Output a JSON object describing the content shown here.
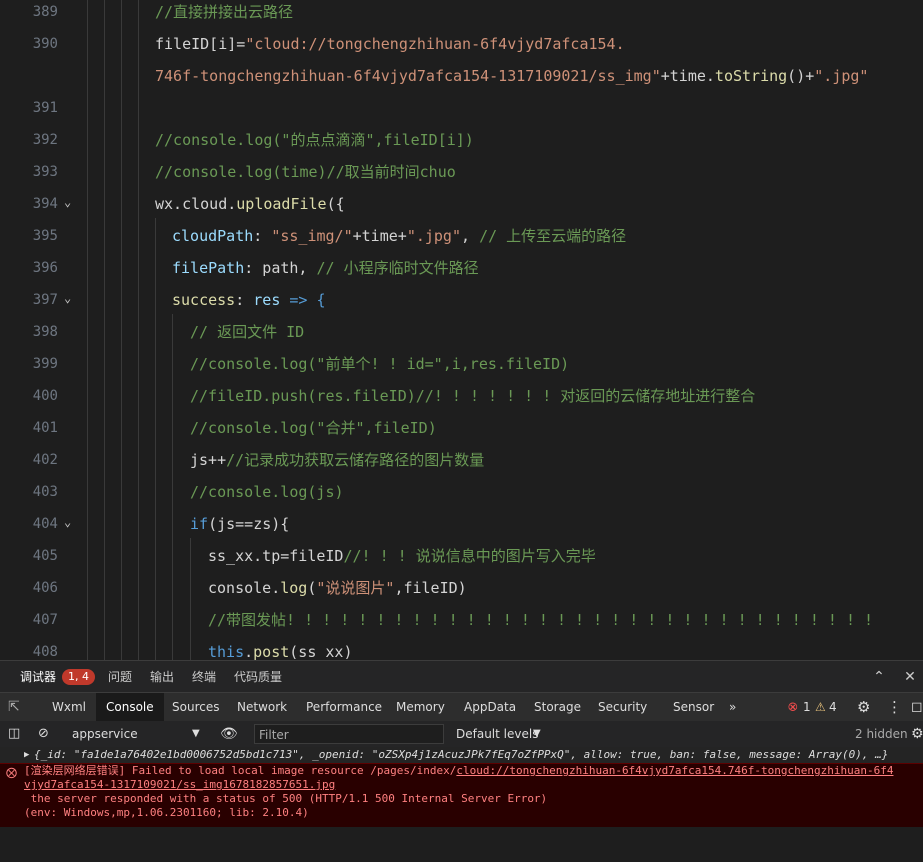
{
  "editor": {
    "lines": [
      {
        "num": "389",
        "fold": false,
        "indent": 155,
        "tokens": [
          {
            "t": "//直接拼接出云路径",
            "c": "c"
          }
        ]
      },
      {
        "num": "390",
        "fold": false,
        "indent": 155,
        "tokens": [
          {
            "t": "fileID[i]=",
            "c": "o"
          },
          {
            "t": "\"cloud://tongchengzhihuan-6f4vjyd7afca154.",
            "c": "s"
          }
        ]
      },
      {
        "num": "",
        "fold": false,
        "indent": 155,
        "tokens": [
          {
            "t": "746f-tongchengzhihuan-6f4vjyd7afca154-1317109021/ss_img\"",
            "c": "s"
          },
          {
            "t": "+time.",
            "c": "o"
          },
          {
            "t": "toString",
            "c": "f"
          },
          {
            "t": "()+",
            "c": "o"
          },
          {
            "t": "\".jpg\"",
            "c": "s"
          }
        ]
      },
      {
        "num": "391",
        "fold": false,
        "indent": 155,
        "tokens": []
      },
      {
        "num": "392",
        "fold": false,
        "indent": 155,
        "tokens": [
          {
            "t": "//console.log(\"的点点滴滴\",fileID[i])",
            "c": "c"
          }
        ]
      },
      {
        "num": "393",
        "fold": false,
        "indent": 155,
        "tokens": [
          {
            "t": "//console.log(time)//取当前时间chuo",
            "c": "c"
          }
        ]
      },
      {
        "num": "394",
        "fold": true,
        "indent": 155,
        "tokens": [
          {
            "t": "wx.cloud.",
            "c": "o"
          },
          {
            "t": "uploadFile",
            "c": "f"
          },
          {
            "t": "({",
            "c": "o"
          }
        ]
      },
      {
        "num": "395",
        "fold": false,
        "indent": 172,
        "tokens": [
          {
            "t": "cloudPath",
            "c": "v"
          },
          {
            "t": ": ",
            "c": "o"
          },
          {
            "t": "\"ss_img/\"",
            "c": "s"
          },
          {
            "t": "+time+",
            "c": "o"
          },
          {
            "t": "\".jpg\"",
            "c": "s"
          },
          {
            "t": ", ",
            "c": "o"
          },
          {
            "t": "// 上传至云端的路径",
            "c": "c"
          }
        ]
      },
      {
        "num": "396",
        "fold": false,
        "indent": 172,
        "tokens": [
          {
            "t": "filePath",
            "c": "v"
          },
          {
            "t": ": path, ",
            "c": "o"
          },
          {
            "t": "// 小程序临时文件路径",
            "c": "c"
          }
        ]
      },
      {
        "num": "397",
        "fold": true,
        "indent": 172,
        "tokens": [
          {
            "t": "success",
            "c": "f"
          },
          {
            "t": ": ",
            "c": "o"
          },
          {
            "t": "res",
            "c": "r"
          },
          {
            "t": " => {",
            "c": "k"
          }
        ]
      },
      {
        "num": "398",
        "fold": false,
        "indent": 190,
        "tokens": [
          {
            "t": "// 返回文件 ID",
            "c": "c"
          }
        ]
      },
      {
        "num": "399",
        "fold": false,
        "indent": 190,
        "tokens": [
          {
            "t": "//console.log(\"前单个! ! id=\",i,res.fileID)",
            "c": "c"
          }
        ]
      },
      {
        "num": "400",
        "fold": false,
        "indent": 190,
        "tokens": [
          {
            "t": "//fileID.push(res.fileID)//! ! ! ! ! ! ! 对返回的云储存地址进行整合",
            "c": "c"
          }
        ]
      },
      {
        "num": "401",
        "fold": false,
        "indent": 190,
        "tokens": [
          {
            "t": "//console.log(\"合并\",fileID)",
            "c": "c"
          }
        ]
      },
      {
        "num": "402",
        "fold": false,
        "indent": 190,
        "tokens": [
          {
            "t": "js++",
            "c": "o"
          },
          {
            "t": "//记录成功获取云储存路径的图片数量",
            "c": "c"
          }
        ]
      },
      {
        "num": "403",
        "fold": false,
        "indent": 190,
        "tokens": [
          {
            "t": "//console.log(js)",
            "c": "c"
          }
        ]
      },
      {
        "num": "404",
        "fold": true,
        "indent": 190,
        "tokens": [
          {
            "t": "if",
            "c": "k"
          },
          {
            "t": "(js==zs){",
            "c": "o"
          }
        ]
      },
      {
        "num": "405",
        "fold": false,
        "indent": 208,
        "tokens": [
          {
            "t": "ss_xx.tp=fileID",
            "c": "o"
          },
          {
            "t": "//! ! ! 说说信息中的图片写入完毕",
            "c": "c"
          }
        ]
      },
      {
        "num": "406",
        "fold": false,
        "indent": 208,
        "tokens": [
          {
            "t": "console.",
            "c": "o"
          },
          {
            "t": "log",
            "c": "f"
          },
          {
            "t": "(",
            "c": "o"
          },
          {
            "t": "\"说说图片\"",
            "c": "s"
          },
          {
            "t": ",fileID)",
            "c": "o"
          }
        ]
      },
      {
        "num": "407",
        "fold": false,
        "indent": 208,
        "tokens": [
          {
            "t": "//带图发帖! ! ! ! ! ! ! ! ! ! ! ! ! ! ! ! ! ! ! ! ! ! ! ! ! ! ! ! ! ! ! ! !",
            "c": "c"
          }
        ]
      },
      {
        "num": "408",
        "fold": false,
        "indent": 208,
        "tokens": [
          {
            "t": "this",
            "c": "k"
          },
          {
            "t": ".",
            "c": "o"
          },
          {
            "t": "post",
            "c": "f"
          },
          {
            "t": "(ss_xx)",
            "c": "o"
          }
        ]
      }
    ]
  },
  "panel": {
    "tabs": [
      "调试器",
      "问题",
      "输出",
      "终端",
      "代码质量"
    ],
    "debugger_badge": "1, 4",
    "devtools_tabs": [
      "Wxml",
      "Console",
      "Sources",
      "Network",
      "Performance",
      "Memory",
      "AppData",
      "Storage",
      "Security",
      "Sensor"
    ],
    "active_devtab": "Console",
    "more": "»",
    "error_count": "1",
    "warn_count": "4",
    "context": "appservice",
    "filter_placeholder": "Filter",
    "levels": "Default levels",
    "hidden": "2 hidden",
    "object_line": "{_id: \"fa1de1a76402e1bd0006752d5bd1c713\", _openid: \"oZSXp4j1zAcuzJPk7fEq7oZfPPxQ\", allow: true, ban: false, message: Array(0), …}",
    "error_prefix": "[渲染层网络层错误] Failed to load local image resource /pages/index/",
    "error_link1": "cloud://tongchengzhihuan-6f4vjyd7afca154.746f-tongchengzhihuan-6f4",
    "error_link2": "vjyd7afca154-1317109021/ss_img1678182857651.jpg",
    "error_line3": " the server responded with a status of 500 (HTTP/1.1 500 Internal Server Error)",
    "error_line4": "(env: Windows,mp,1.06.2301160; lib: 2.10.4)"
  }
}
